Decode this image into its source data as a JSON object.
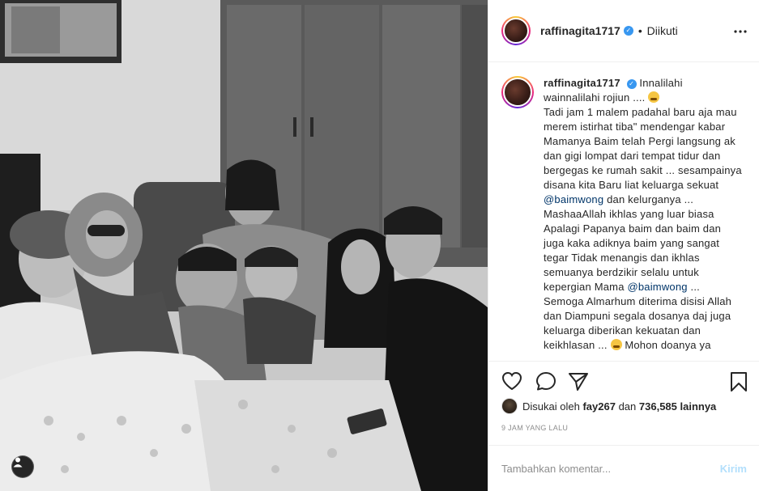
{
  "header": {
    "username": "raffinagita1717",
    "follow_separator": "•",
    "follow_state": "Diikuti",
    "more_icon": "more-horizontal-icon"
  },
  "caption": {
    "username": "raffinagita1717",
    "part1": "Innalilahi wainnalilahi rojiun ....",
    "part2": "Tadi jam 1 malem padahal baru aja mau merem istirhat tiba\" mendengar kabar Mamanya Baim telah Pergi langsung ak dan gigi lompat dari tempat tidur dan bergegas ke rumah sakit ... sesampainya disana kita Baru liat keluarga sekuat",
    "mention1": "@baimwong",
    "part3": "dan kelurganya ... MashaaAllah ikhlas yang luar biasa Apalagi Papanya baim dan baim dan juga kaka adiknya baim yang sangat tegar Tidak menangis dan ikhlas semuanya berdzikir selalu untuk kepergian Mama",
    "mention2": "@baimwong",
    "part4": "... Semoga Almarhum diterima disisi Allah dan Diampuni segala dosanya daj juga keluarga diberikan kekuatan dan keikhlasan ...",
    "part5": "Mohon doanya ya"
  },
  "actions": {
    "like_icon": "heart-icon",
    "comment_icon": "comment-icon",
    "share_icon": "share-icon",
    "save_icon": "bookmark-icon"
  },
  "likes": {
    "prefix": "Disukai oleh",
    "user": "fay267",
    "middle": "dan",
    "count": "736,585 lainnya"
  },
  "timeago": "9 JAM YANG LALU",
  "comment_box": {
    "placeholder": "Tambahkan komentar...",
    "post_label": "Kirim"
  },
  "photo": {
    "tag_icon": "user-tag-icon"
  }
}
